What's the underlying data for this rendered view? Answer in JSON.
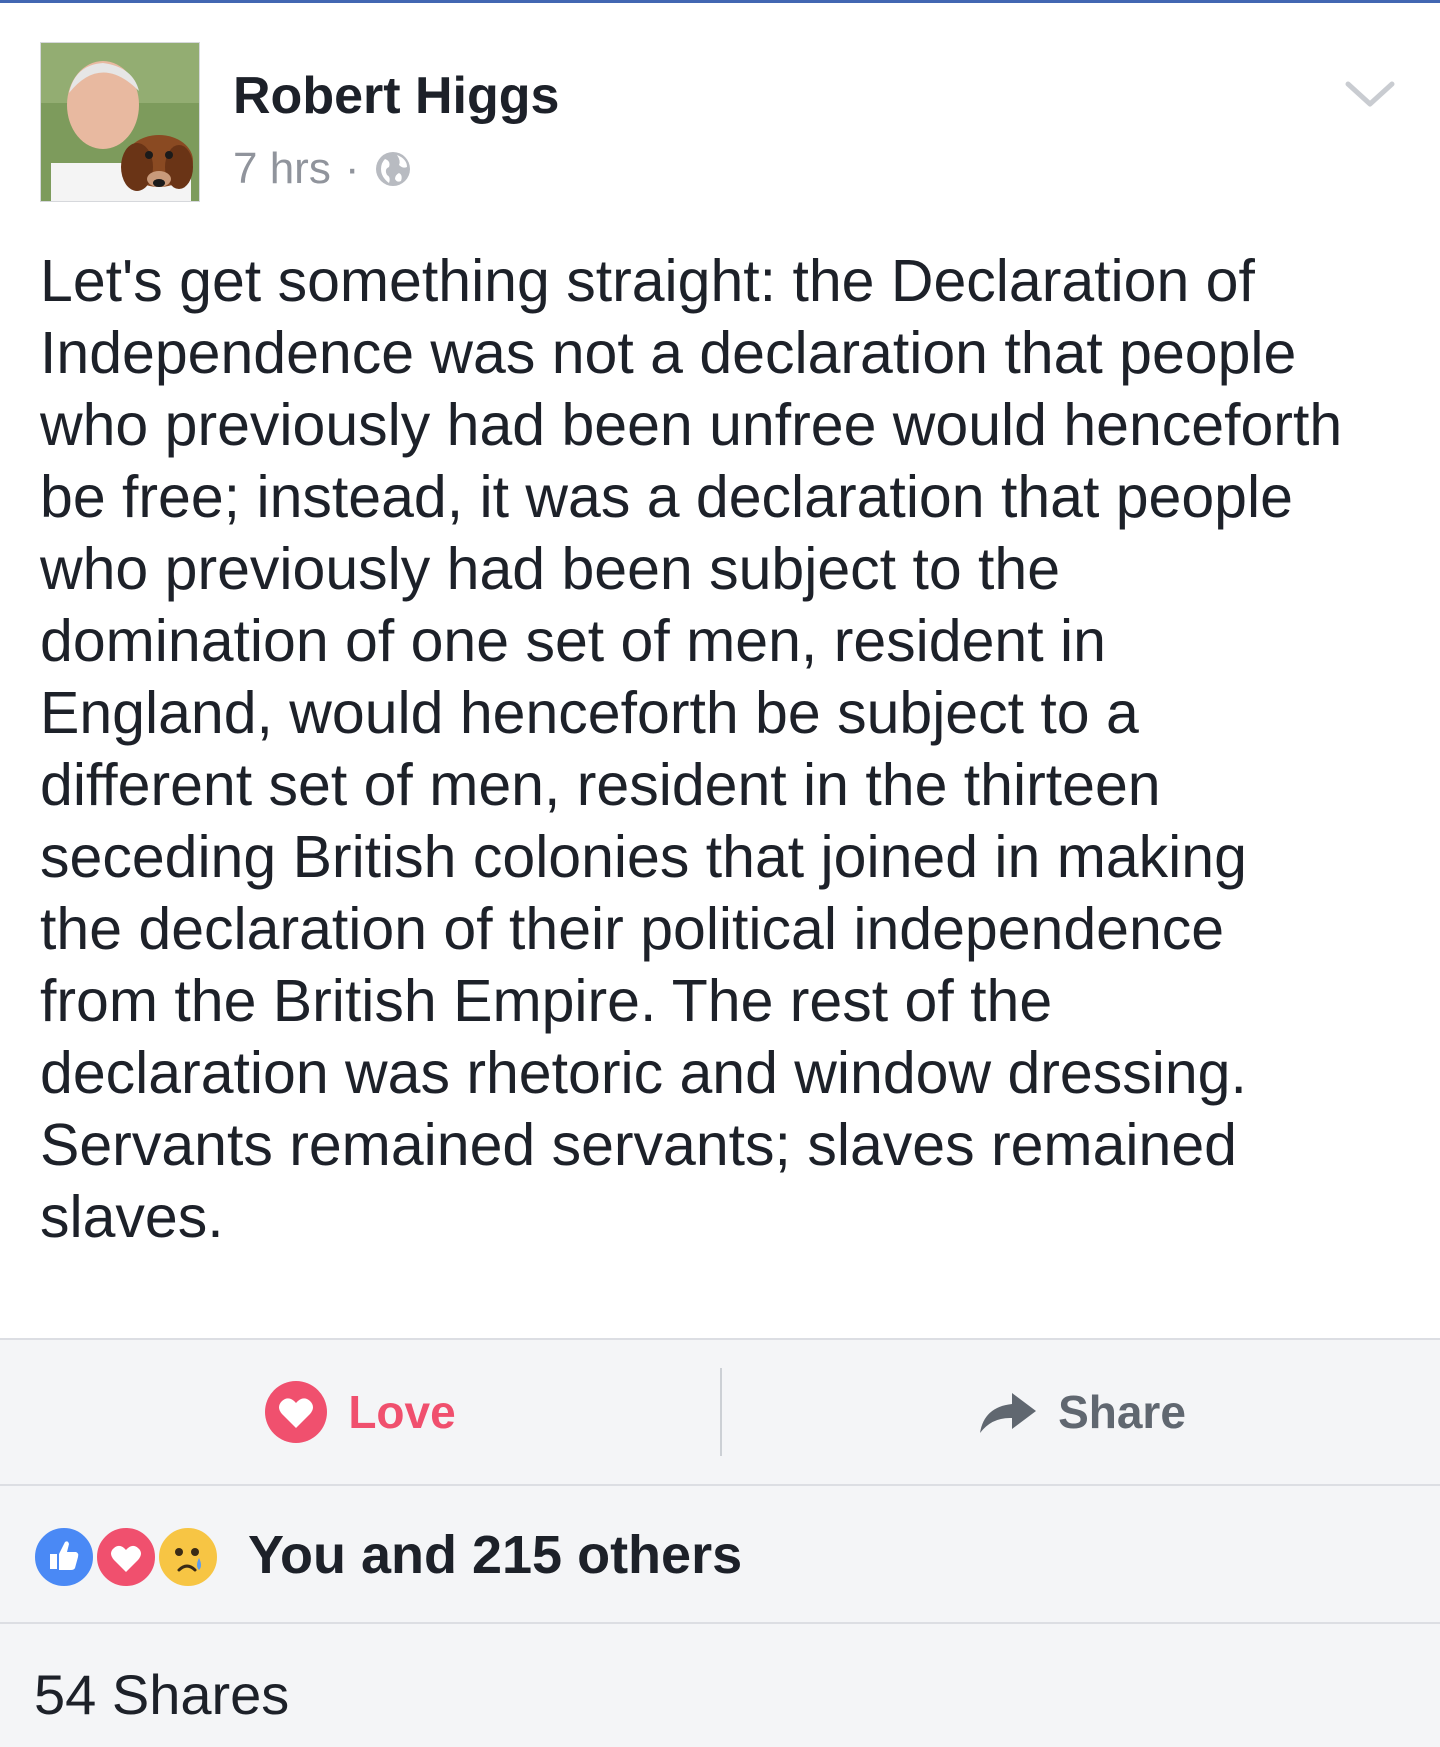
{
  "post": {
    "author": "Robert Higgs",
    "time": "7 hrs",
    "separator": "·",
    "privacy_icon": "globe-icon",
    "menu_icon": "chevron-down-icon",
    "text": "Let's get something straight: the Declaration of\nIndependence was not a declaration that people\nwho previously had been unfree would henceforth\nbe free; instead, it was a declaration that people\nwho previously had been subject to the\ndomination of one set of men, resident in\nEngland, would henceforth be subject to a\ndifferent set of men, resident in the thirteen\nseceding British colonies that joined in making\nthe declaration of their political independence\nfrom the British Empire. The rest of the\ndeclaration was rhetoric and window dressing.\nServants remained servants; slaves remained\nslaves."
  },
  "actions": {
    "love_label": "Love",
    "love_icon": "heart-icon",
    "share_label": "Share",
    "share_icon": "share-arrow-icon"
  },
  "reactions": {
    "icons": [
      "like-icon",
      "love-icon",
      "sad-icon"
    ],
    "summary": "You and 215 others"
  },
  "shares": {
    "count_label": "54 Shares"
  },
  "colors": {
    "love": "#f0506e",
    "like": "#4a89f5",
    "sad": "#f7c544",
    "muted": "#90949c",
    "text": "#1d2129",
    "bar_bg": "#f4f5f7"
  }
}
